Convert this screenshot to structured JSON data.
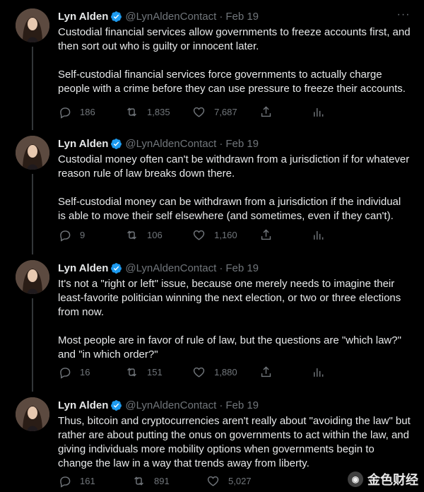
{
  "tweets": [
    {
      "name": "Lyn Alden",
      "handle": "@LynAldenContact",
      "date": "Feb 19",
      "text": "Custodial financial services allow governments to freeze accounts first, and then sort out who is guilty or innocent later.\n\nSelf-custodial financial services force governments to actually charge people with a crime before they can use pressure to freeze their accounts.",
      "replies": "186",
      "retweets": "1,835",
      "likes": "7,687"
    },
    {
      "name": "Lyn Alden",
      "handle": "@LynAldenContact",
      "date": "Feb 19",
      "text": "Custodial money often can't be withdrawn from a jurisdiction if for whatever reason rule of law breaks down there.\n\nSelf-custodial money can be withdrawn from a jurisdiction if the individual is able to move their self elsewhere (and sometimes, even if they can't).",
      "replies": "9",
      "retweets": "106",
      "likes": "1,160"
    },
    {
      "name": "Lyn Alden",
      "handle": "@LynAldenContact",
      "date": "Feb 19",
      "text": "It's not a \"right or left\" issue, because one merely needs to imagine their least-favorite politician winning the next election, or two or three elections from now.\n\nMost people are in favor of rule of law, but the questions are \"which law?\" and \"in which order?\"",
      "replies": "16",
      "retweets": "151",
      "likes": "1,880"
    },
    {
      "name": "Lyn Alden",
      "handle": "@LynAldenContact",
      "date": "Feb 19",
      "text": "Thus, bitcoin and cryptocurrencies aren't really about \"avoiding the law\" but rather are about putting the onus on governments to act within the law, and giving individuals more mobility options when governments begin to change the law in a way that trends away from liberty.",
      "replies": "161",
      "retweets": "891",
      "likes": "5,027"
    }
  ],
  "separator": "·",
  "watermark": "金色财经",
  "colors": {
    "background": "#000000",
    "text": "#e7e9ea",
    "muted": "#71767b",
    "verified": "#1d9bf0",
    "thread_line": "#333639"
  },
  "icons": [
    "verified-badge-icon",
    "more-icon",
    "reply-icon",
    "retweet-icon",
    "like-icon",
    "share-icon",
    "analytics-icon"
  ]
}
